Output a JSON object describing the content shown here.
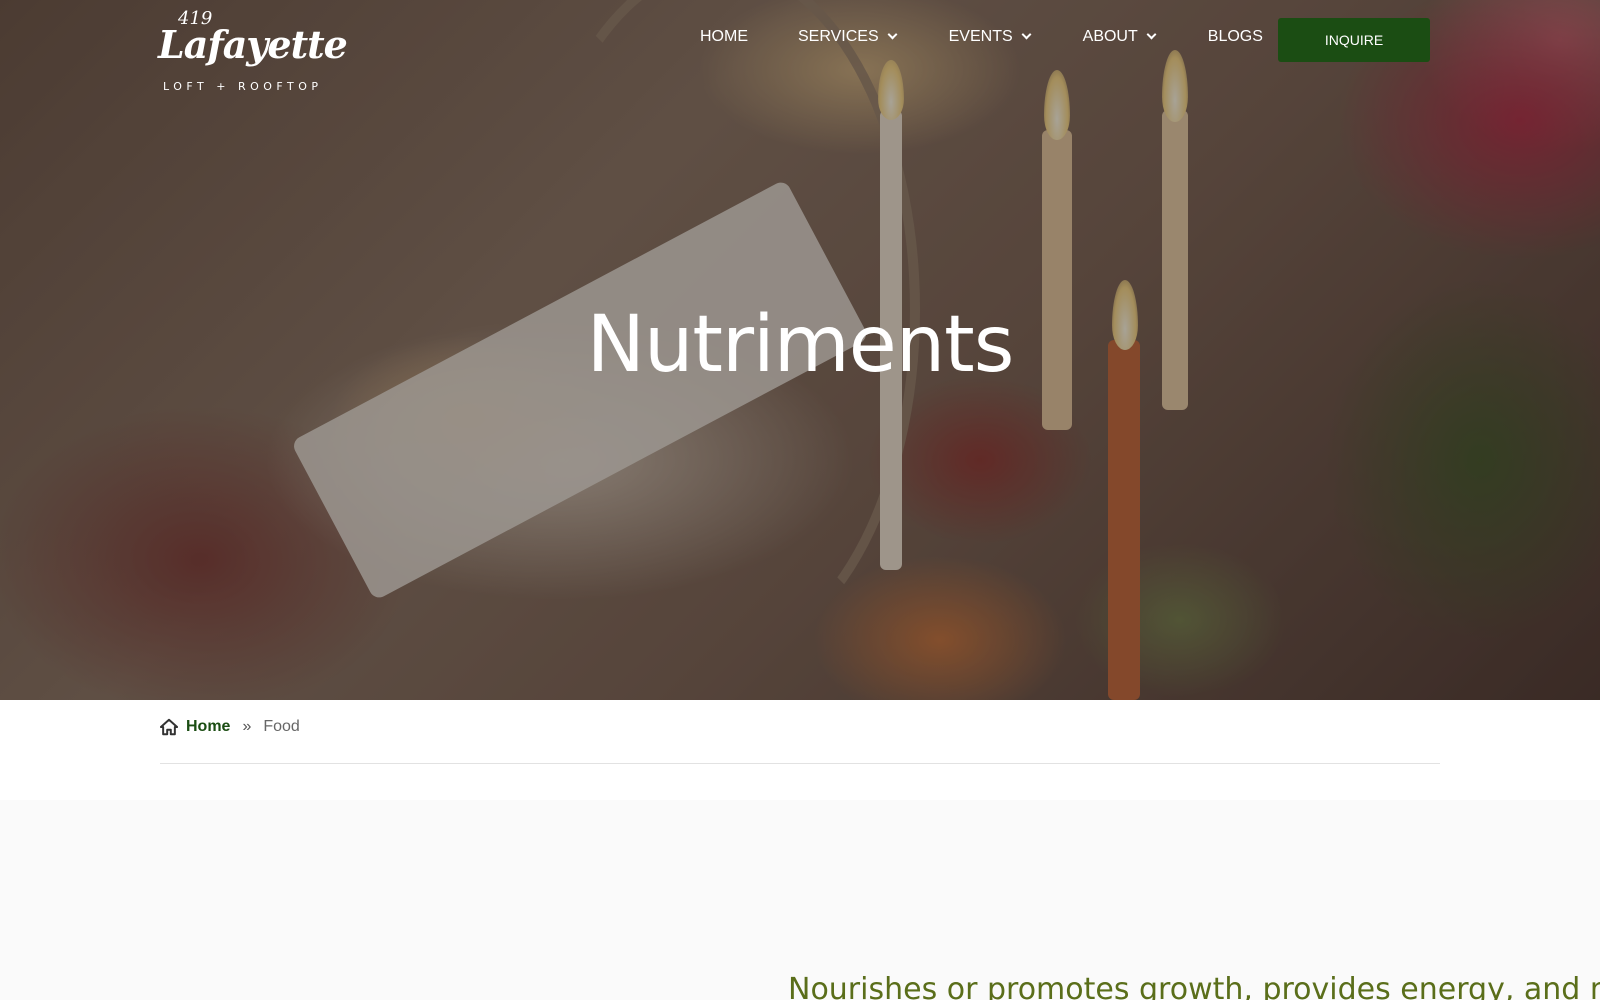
{
  "brand": {
    "number": "419",
    "name": "Lafayette",
    "tagline": "LOFT + ROOFTOP"
  },
  "nav": {
    "items": [
      {
        "label": "HOME",
        "has_dropdown": false
      },
      {
        "label": "SERVICES",
        "has_dropdown": true
      },
      {
        "label": "EVENTS",
        "has_dropdown": true
      },
      {
        "label": "ABOUT",
        "has_dropdown": true
      },
      {
        "label": "BLOGS",
        "has_dropdown": false
      }
    ],
    "cta_label": "INQUIRE"
  },
  "hero": {
    "title": "Nutriments"
  },
  "breadcrumb": {
    "home": "Home",
    "separator": "»",
    "current": "Food"
  },
  "content": {
    "intro": "Nourishes or promotes growth, provides energy, and m"
  },
  "colors": {
    "accent_green": "#1b4d13",
    "text_olive": "#5a6e1a"
  }
}
